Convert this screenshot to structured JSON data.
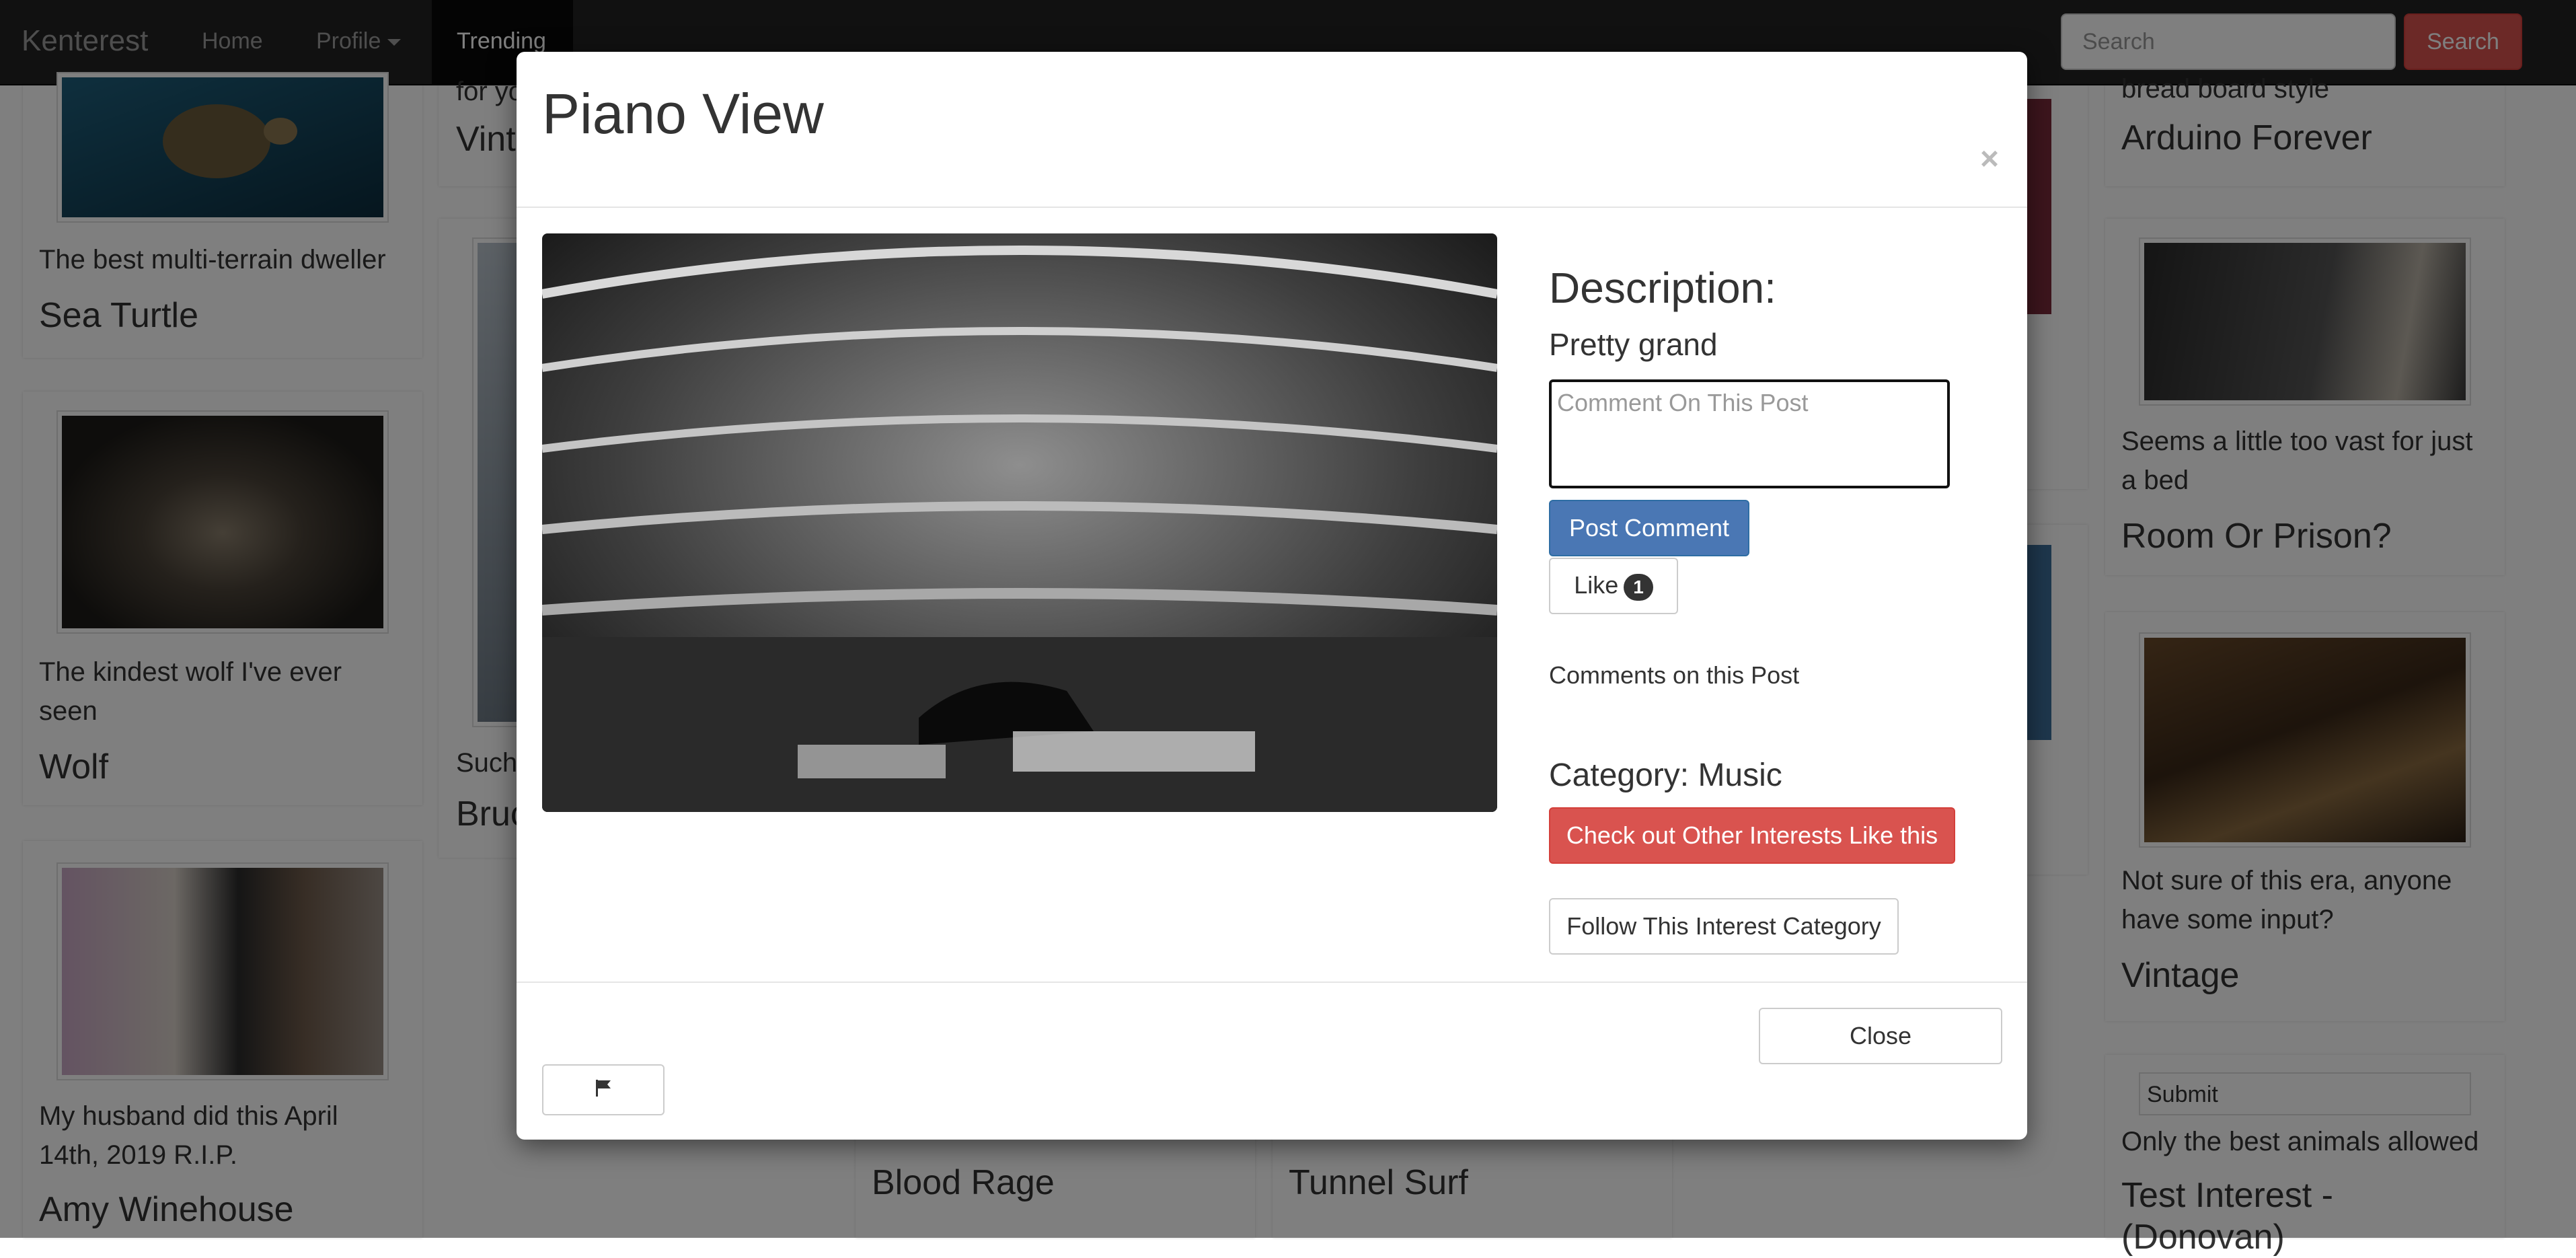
{
  "navbar": {
    "brand": "Kenterest",
    "home": "Home",
    "profile": "Profile",
    "trending": "Trending",
    "search_placeholder": "Search",
    "search_button": "Search"
  },
  "background_cards": {
    "col1": [
      {
        "caption": "The best multi-terrain dweller",
        "title": "Sea Turtle"
      },
      {
        "caption": "The kindest wolf I've ever seen",
        "title": "Wolf"
      },
      {
        "caption": "My husband did this April 14th, 2019 R.I.P.",
        "title": "Amy Winehouse"
      }
    ],
    "col2": [
      {
        "caption": "for yo",
        "title": "Vinta"
      },
      {
        "caption": "Such",
        "title": "Bruc"
      }
    ],
    "col3": [
      {
        "title": "Blood Rage"
      }
    ],
    "col4": [
      {
        "title": "Tunnel Surf"
      }
    ],
    "col6": [
      {
        "caption": "bread board style",
        "title": "Arduino Forever"
      },
      {
        "caption": "Seems a little too vast for just a bed",
        "title": "Room Or Prison?"
      },
      {
        "caption": "Not sure of this era, anyone have some input?",
        "title": "Vintage"
      },
      {
        "image_alt": "Submit",
        "caption": "Only the best animals allowed",
        "title": "Test Interest - (Donovan)"
      }
    ]
  },
  "modal": {
    "title": "Piano View",
    "close_symbol": "×",
    "description_heading": "Description:",
    "description": "Pretty grand",
    "comment_placeholder": "Comment On This Post",
    "post_comment": "Post Comment",
    "like_label": "Like",
    "like_count": "1",
    "comments_heading": "Comments on this Post",
    "category": "Category: Music",
    "check_out": "Check out Other Interests Like this",
    "follow": "Follow This Interest Category",
    "close_button": "Close",
    "flag_icon": "flag-icon"
  }
}
